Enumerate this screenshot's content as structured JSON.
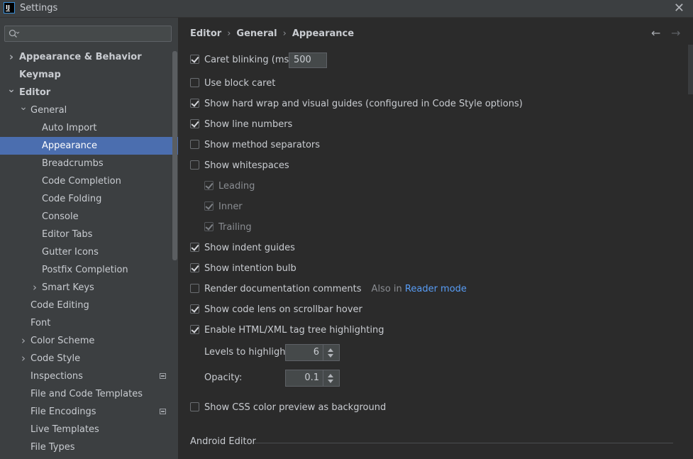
{
  "window": {
    "title": "Settings",
    "app_icon_text": "IJ"
  },
  "search": {
    "placeholder": ""
  },
  "breadcrumb": [
    "Editor",
    "General",
    "Appearance"
  ],
  "tree": [
    {
      "label": "Appearance & Behavior",
      "level": 0,
      "arrow": "right",
      "bold": true
    },
    {
      "label": "Keymap",
      "level": 0,
      "arrow": "",
      "bold": true
    },
    {
      "label": "Editor",
      "level": 0,
      "arrow": "down",
      "bold": true
    },
    {
      "label": "General",
      "level": 1,
      "arrow": "down"
    },
    {
      "label": "Auto Import",
      "level": 2,
      "arrow": ""
    },
    {
      "label": "Appearance",
      "level": 2,
      "arrow": "",
      "selected": true
    },
    {
      "label": "Breadcrumbs",
      "level": 2,
      "arrow": ""
    },
    {
      "label": "Code Completion",
      "level": 2,
      "arrow": ""
    },
    {
      "label": "Code Folding",
      "level": 2,
      "arrow": ""
    },
    {
      "label": "Console",
      "level": 2,
      "arrow": ""
    },
    {
      "label": "Editor Tabs",
      "level": 2,
      "arrow": ""
    },
    {
      "label": "Gutter Icons",
      "level": 2,
      "arrow": ""
    },
    {
      "label": "Postfix Completion",
      "level": 2,
      "arrow": ""
    },
    {
      "label": "Smart Keys",
      "level": 2,
      "arrow": "right"
    },
    {
      "label": "Code Editing",
      "level": 1,
      "arrow": ""
    },
    {
      "label": "Font",
      "level": 1,
      "arrow": ""
    },
    {
      "label": "Color Scheme",
      "level": 1,
      "arrow": "right"
    },
    {
      "label": "Code Style",
      "level": 1,
      "arrow": "right"
    },
    {
      "label": "Inspections",
      "level": 1,
      "arrow": "",
      "badge": true
    },
    {
      "label": "File and Code Templates",
      "level": 1,
      "arrow": ""
    },
    {
      "label": "File Encodings",
      "level": 1,
      "arrow": "",
      "badge": true
    },
    {
      "label": "Live Templates",
      "level": 1,
      "arrow": ""
    },
    {
      "label": "File Types",
      "level": 1,
      "arrow": ""
    }
  ],
  "options": {
    "caret_blinking": {
      "label": "Caret blinking (ms):",
      "checked": true,
      "value": "500"
    },
    "block_caret": {
      "label": "Use block caret",
      "checked": false
    },
    "hard_wrap": {
      "label": "Show hard wrap and visual guides (configured in Code Style options)",
      "checked": true
    },
    "line_numbers": {
      "label": "Show line numbers",
      "checked": true
    },
    "method_separators": {
      "label": "Show method separators",
      "checked": false
    },
    "whitespaces": {
      "label": "Show whitespaces",
      "checked": false
    },
    "leading": {
      "label": "Leading",
      "checked": true
    },
    "inner": {
      "label": "Inner",
      "checked": true
    },
    "trailing": {
      "label": "Trailing",
      "checked": true
    },
    "indent_guides": {
      "label": "Show indent guides",
      "checked": true
    },
    "intention_bulb": {
      "label": "Show intention bulb",
      "checked": true
    },
    "render_docs": {
      "label": "Render documentation comments",
      "checked": false,
      "hint": "Also in",
      "link": "Reader mode"
    },
    "code_lens": {
      "label": "Show code lens on scrollbar hover",
      "checked": true
    },
    "tag_tree": {
      "label": "Enable HTML/XML tag tree highlighting",
      "checked": true
    },
    "levels": {
      "label": "Levels to highlight:",
      "value": "6"
    },
    "opacity": {
      "label": "Opacity:",
      "value": "0.1"
    },
    "css_preview": {
      "label": "Show CSS color preview as background",
      "checked": false
    }
  },
  "section": {
    "android_editor": "Android Editor"
  }
}
